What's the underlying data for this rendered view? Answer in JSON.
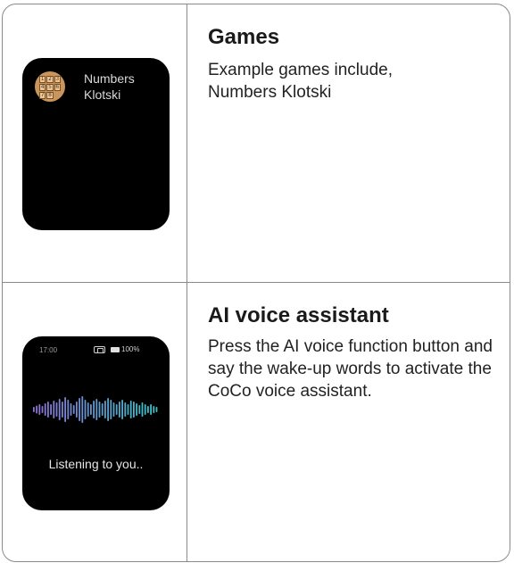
{
  "rows": [
    {
      "title": "Games",
      "description": "Example games include, Numbers Klotski",
      "watch": {
        "app_name_line1": "Numbers",
        "app_name_line2": "Klotski",
        "icon": "numbers-klotski-icon",
        "tiles": [
          "1",
          "2",
          "3",
          "4",
          "5",
          "6",
          "7",
          "8",
          ""
        ]
      }
    },
    {
      "title": "AI voice assistant",
      "description": "Press the AI voice function button and say the wake-up words to activate the CoCo voice assistant.",
      "watch": {
        "time": "17:00",
        "battery": "100%",
        "status_text": "Listening to you..",
        "icons": [
          "bluetooth-icon",
          "battery-icon",
          "waveform-icon"
        ]
      }
    }
  ],
  "colors": {
    "border": "#8a8a8a",
    "watch_bg": "#000000",
    "wave_start": "#8f6fd6",
    "wave_end": "#37c4c9"
  }
}
